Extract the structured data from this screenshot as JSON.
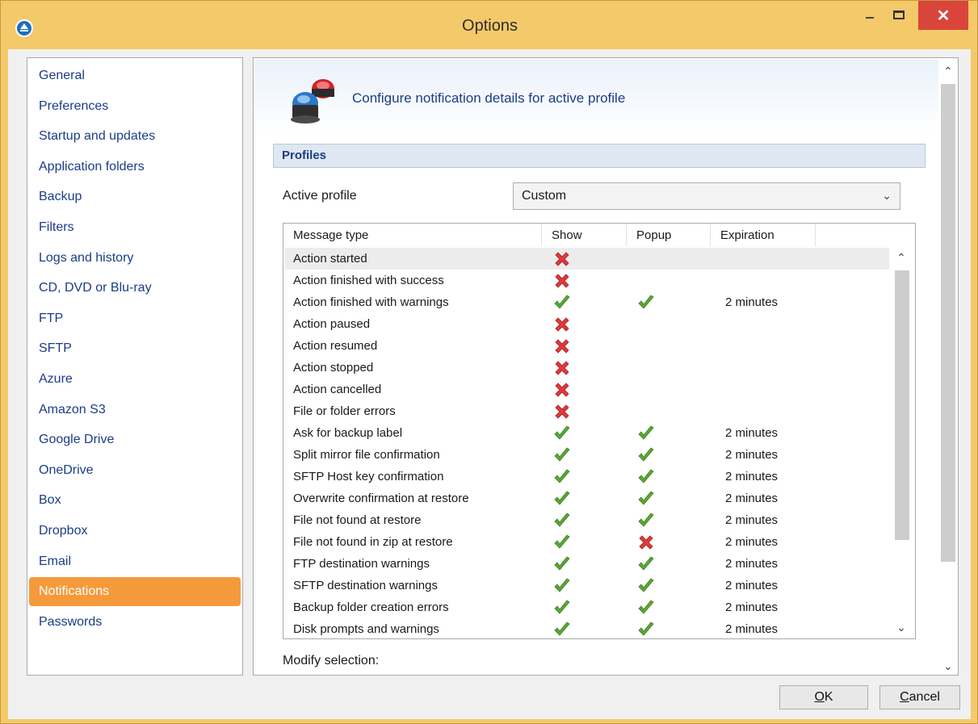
{
  "window": {
    "title": "Options",
    "minimize_icon": "minimize-icon",
    "maximize_icon": "maximize-icon",
    "close_glyph": "✕"
  },
  "sidebar": {
    "items": [
      {
        "label": "General",
        "active": false
      },
      {
        "label": "Preferences",
        "active": false
      },
      {
        "label": "Startup and updates",
        "active": false
      },
      {
        "label": "Application folders",
        "active": false
      },
      {
        "label": "Backup",
        "active": false
      },
      {
        "label": "Filters",
        "active": false
      },
      {
        "label": "Logs and history",
        "active": false
      },
      {
        "label": "CD, DVD or Blu-ray",
        "active": false
      },
      {
        "label": "FTP",
        "active": false
      },
      {
        "label": "SFTP",
        "active": false
      },
      {
        "label": "Azure",
        "active": false
      },
      {
        "label": "Amazon S3",
        "active": false
      },
      {
        "label": "Google Drive",
        "active": false
      },
      {
        "label": "OneDrive",
        "active": false
      },
      {
        "label": "Box",
        "active": false
      },
      {
        "label": "Dropbox",
        "active": false
      },
      {
        "label": "Email",
        "active": false
      },
      {
        "label": "Notifications",
        "active": true
      },
      {
        "label": "Passwords",
        "active": false
      }
    ]
  },
  "panel": {
    "header_text": "Configure notification details for active profile",
    "section_title": "Profiles",
    "active_profile_label": "Active profile",
    "active_profile_value": "Custom",
    "modify_label": "Modify selection:"
  },
  "table": {
    "columns": [
      "Message type",
      "Show",
      "Popup",
      "Expiration"
    ],
    "rows": [
      {
        "type": "Action started",
        "show": false,
        "popup": null,
        "expiration": ""
      },
      {
        "type": "Action finished with success",
        "show": false,
        "popup": null,
        "expiration": ""
      },
      {
        "type": "Action finished with warnings",
        "show": true,
        "popup": true,
        "expiration": "2 minutes"
      },
      {
        "type": "Action paused",
        "show": false,
        "popup": null,
        "expiration": ""
      },
      {
        "type": "Action resumed",
        "show": false,
        "popup": null,
        "expiration": ""
      },
      {
        "type": "Action stopped",
        "show": false,
        "popup": null,
        "expiration": ""
      },
      {
        "type": "Action cancelled",
        "show": false,
        "popup": null,
        "expiration": ""
      },
      {
        "type": "File or folder errors",
        "show": false,
        "popup": null,
        "expiration": ""
      },
      {
        "type": "Ask for backup label",
        "show": true,
        "popup": true,
        "expiration": "2 minutes"
      },
      {
        "type": "Split mirror file confirmation",
        "show": true,
        "popup": true,
        "expiration": "2 minutes"
      },
      {
        "type": "SFTP Host key confirmation",
        "show": true,
        "popup": true,
        "expiration": "2 minutes"
      },
      {
        "type": "Overwrite confirmation at restore",
        "show": true,
        "popup": true,
        "expiration": "2 minutes"
      },
      {
        "type": "File not found at restore",
        "show": true,
        "popup": true,
        "expiration": "2 minutes"
      },
      {
        "type": "File not found in zip at restore",
        "show": true,
        "popup": false,
        "expiration": "2 minutes"
      },
      {
        "type": "FTP destination warnings",
        "show": true,
        "popup": true,
        "expiration": "2 minutes"
      },
      {
        "type": "SFTP destination warnings",
        "show": true,
        "popup": true,
        "expiration": "2 minutes"
      },
      {
        "type": "Backup folder creation errors",
        "show": true,
        "popup": true,
        "expiration": "2 minutes"
      },
      {
        "type": "Disk prompts and warnings",
        "show": true,
        "popup": true,
        "expiration": "2 minutes"
      }
    ]
  },
  "buttons": {
    "ok_prefix": "O",
    "ok_underlined": "K",
    "ok_full": "OK",
    "cancel_underlined": "C",
    "cancel_rest": "ancel"
  },
  "colors": {
    "title_bar": "#f4c96a",
    "active_item": "#f59a3b",
    "close_button": "#d9453a",
    "check_green": "#5aa832",
    "cross_red": "#e0393b",
    "link_blue": "#1b3d86"
  }
}
